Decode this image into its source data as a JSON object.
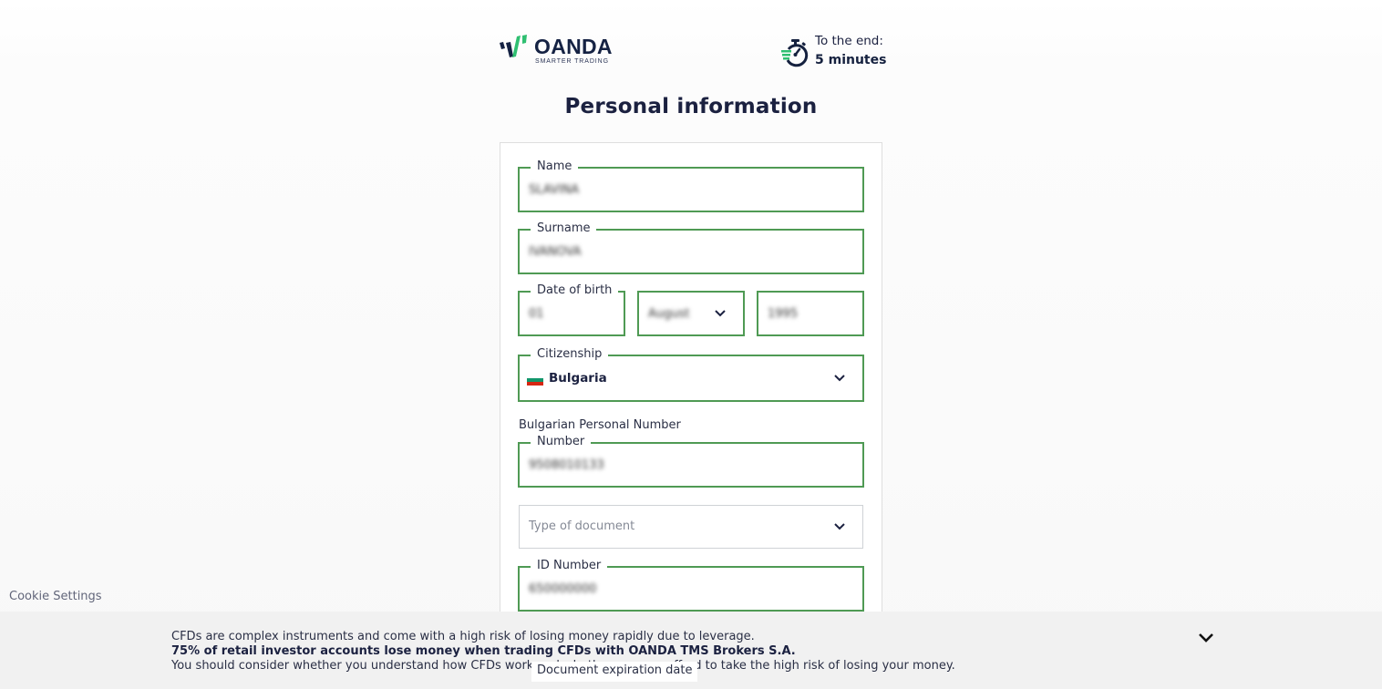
{
  "header": {
    "logo": {
      "wordmark": "OANDA",
      "tagline": "SMARTER TRADING",
      "icon": "oanda-logo-icon"
    },
    "timer": {
      "icon": "stopwatch-icon",
      "label": "To the end:",
      "value": "5 minutes"
    }
  },
  "page_title": "Personal information",
  "colors": {
    "field_border_valid": "#4f9a54",
    "field_border_default": "#cfd2d6",
    "text_primary": "#1b2140",
    "logo_accent": "#2fbf71",
    "banner_bg": "#f1f1f1"
  },
  "form": {
    "name": {
      "label": "Name",
      "value": "SLAVINA"
    },
    "surname": {
      "label": "Surname",
      "value": "IVANOVA"
    },
    "date_of_birth": {
      "label": "Date of birth",
      "day": "01",
      "month": "August",
      "year": "1995"
    },
    "citizenship": {
      "label": "Citizenship",
      "value": "Bulgaria",
      "flag_icon": "bulgaria-flag-icon"
    },
    "personal_number": {
      "section_label": "Bulgarian Personal Number",
      "label": "Number",
      "value": "9508010133"
    },
    "document_type": {
      "placeholder": "Type of document"
    },
    "id_number": {
      "label": "ID Number",
      "value": "650000000"
    },
    "expiration_date": {
      "label": "Document expiration date"
    }
  },
  "cookie_settings": "Cookie Settings",
  "risk_banner": {
    "line1": "CFDs are complex instruments and come with a high risk of losing money rapidly due to leverage.",
    "line2": "75% of retail investor accounts lose money when trading CFDs with OANDA TMS Brokers S.A.",
    "line3": "You should consider whether you understand how CFDs work and whether you can afford to take the high risk of losing your money.",
    "toggle_icon": "chevron-down-icon"
  }
}
